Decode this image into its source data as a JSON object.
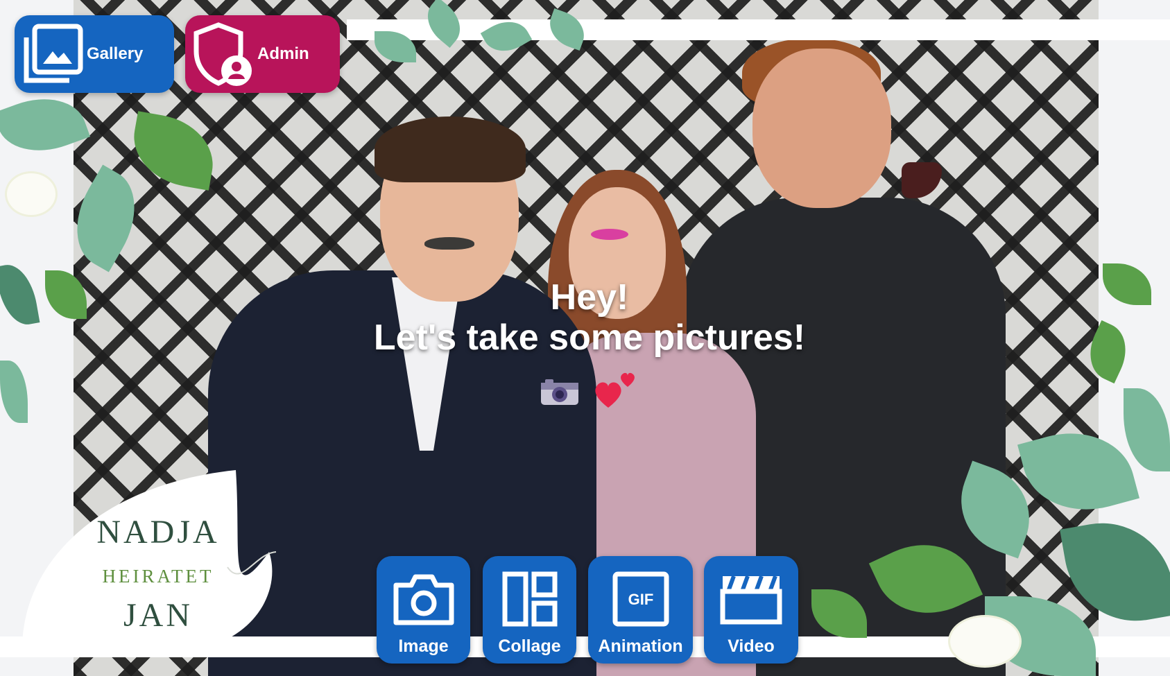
{
  "topbar": {
    "gallery_label": "Gallery",
    "admin_label": "Admin"
  },
  "headline": {
    "line1": "Hey!",
    "line2": "Let's take some pictures!"
  },
  "modes": {
    "image_label": "Image",
    "collage_label": "Collage",
    "animation_label": "Animation",
    "video_label": "Video",
    "gif_icon_text": "GIF"
  },
  "monogram": {
    "name1": "NADJA",
    "connector": "HEIRATET",
    "name2": "JAN"
  },
  "colors": {
    "primary_button": "#1565c0",
    "admin_button": "#b8145a"
  },
  "icons": {
    "gallery": "gallery-icon",
    "admin": "admin-shield-icon",
    "image": "camera-icon",
    "collage": "collage-icon",
    "animation": "gif-icon",
    "video": "clapperboard-icon"
  }
}
